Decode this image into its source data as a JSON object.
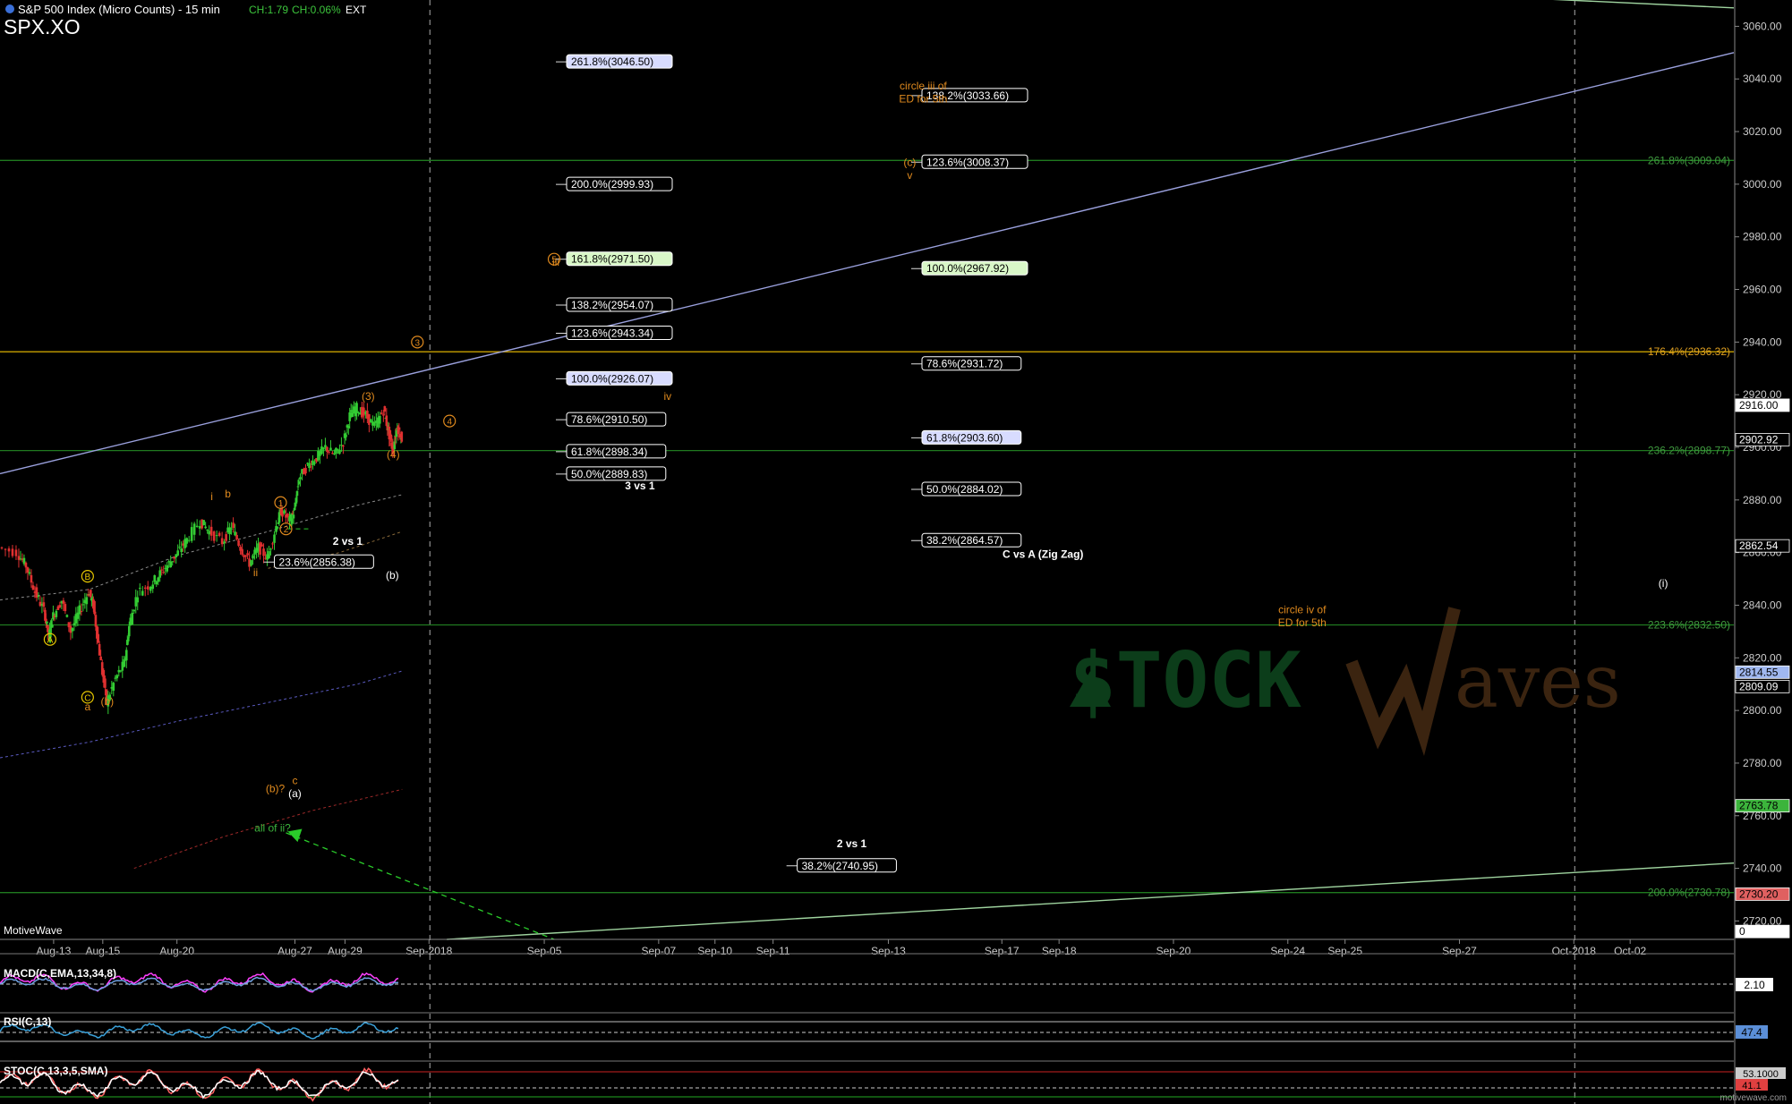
{
  "header": {
    "title": "S&P 500 Index (Micro Counts) - 15 min",
    "change": "CH:1.79",
    "change_pct": "CH:0.06%",
    "session": "EXT",
    "symbol": "SPX.XO"
  },
  "colors": {
    "background": "#000000",
    "grid": "#111111",
    "orange": "#e08a1e",
    "green": "#3cb43c",
    "white": "#ffffff",
    "lavender": "#a0a8e6",
    "dark_green_level": "#1f7a1f",
    "gold_level": "#c8a000",
    "up_candle": "#33cc33",
    "down_candle": "#e03030",
    "dashed_cyan": "#2f6f90"
  },
  "chart_data": {
    "type": "candlestick",
    "title": "S&P 500 Index (Micro Counts) - 15 min",
    "ylim": [
      2713,
      3070
    ],
    "y_ticks": [
      2720,
      2740,
      2760,
      2780,
      2800,
      2820,
      2840,
      2860,
      2880,
      2900,
      2920,
      2940,
      2960,
      2980,
      3000,
      3020,
      3040,
      3060
    ],
    "x_ticks": [
      {
        "label": "Aug-13",
        "slot": 0.06
      },
      {
        "label": "Aug-15",
        "slot": 0.115
      },
      {
        "label": "Aug-20",
        "slot": 0.198
      },
      {
        "label": "Aug-27",
        "slot": 0.33
      },
      {
        "label": "Aug-29",
        "slot": 0.386
      },
      {
        "label": "Sep-2018",
        "slot": 0.48
      },
      {
        "label": "Sep-05",
        "slot": 0.609
      },
      {
        "label": "Sep-07",
        "slot": 0.737
      },
      {
        "label": "Sep-10",
        "slot": 0.8
      },
      {
        "label": "Sep-11",
        "slot": 0.865
      },
      {
        "label": "Sep-13",
        "slot": 0.994
      },
      {
        "label": "Sep-17",
        "slot": 1.121
      },
      {
        "label": "Sep-18",
        "slot": 1.185
      },
      {
        "label": "Sep-20",
        "slot": 1.313
      },
      {
        "label": "Sep-24",
        "slot": 1.441
      },
      {
        "label": "Sep-25",
        "slot": 1.505
      },
      {
        "label": "Sep-27",
        "slot": 1.633
      },
      {
        "label": "Oct-2018",
        "slot": 1.761
      },
      {
        "label": "Oct-02",
        "slot": 1.824
      }
    ],
    "x_extent": [
      0,
      1.94
    ],
    "price_path": [
      [
        0.0,
        2862
      ],
      [
        0.02,
        2860
      ],
      [
        0.03,
        2855
      ],
      [
        0.04,
        2845
      ],
      [
        0.05,
        2838
      ],
      [
        0.055,
        2828
      ],
      [
        0.06,
        2836
      ],
      [
        0.07,
        2842
      ],
      [
        0.08,
        2830
      ],
      [
        0.09,
        2838
      ],
      [
        0.1,
        2845
      ],
      [
        0.105,
        2840
      ],
      [
        0.112,
        2822
      ],
      [
        0.12,
        2803
      ],
      [
        0.13,
        2812
      ],
      [
        0.14,
        2818
      ],
      [
        0.145,
        2832
      ],
      [
        0.155,
        2845
      ],
      [
        0.17,
        2848
      ],
      [
        0.18,
        2852
      ],
      [
        0.19,
        2856
      ],
      [
        0.2,
        2860
      ],
      [
        0.21,
        2865
      ],
      [
        0.225,
        2872
      ],
      [
        0.235,
        2868
      ],
      [
        0.25,
        2864
      ],
      [
        0.26,
        2870
      ],
      [
        0.27,
        2862
      ],
      [
        0.28,
        2856
      ],
      [
        0.29,
        2862
      ],
      [
        0.3,
        2858
      ],
      [
        0.31,
        2870
      ],
      [
        0.315,
        2876
      ],
      [
        0.325,
        2872
      ],
      [
        0.33,
        2876
      ],
      [
        0.335,
        2888
      ],
      [
        0.345,
        2893
      ],
      [
        0.355,
        2896
      ],
      [
        0.365,
        2900
      ],
      [
        0.375,
        2897
      ],
      [
        0.385,
        2902
      ],
      [
        0.392,
        2912
      ],
      [
        0.4,
        2915
      ],
      [
        0.41,
        2912
      ],
      [
        0.42,
        2908
      ],
      [
        0.43,
        2914
      ],
      [
        0.435,
        2906
      ],
      [
        0.44,
        2899
      ],
      [
        0.445,
        2908
      ],
      [
        0.45,
        2903
      ]
    ],
    "horizontal_levels": [
      {
        "label": "261.8%(3009.04)",
        "value": 3009.04,
        "color": "dark_green_level"
      },
      {
        "label": "176.4%(2936.32)",
        "value": 2936.32,
        "color": "gold_level"
      },
      {
        "label": "236.2%(2898.77)",
        "value": 2898.77,
        "color": "dark_green_level"
      },
      {
        "label": "223.6%(2832.50)",
        "value": 2832.5,
        "color": "dark_green_level"
      },
      {
        "label": "200.0%(2730.78)",
        "value": 2730.78,
        "color": "dark_green_level"
      }
    ],
    "fib_left": [
      {
        "label": "261.8%(3046.50)",
        "value": 3046.5,
        "style": "lavender"
      },
      {
        "label": "200.0%(2999.93)",
        "value": 2999.93,
        "style": "plain"
      },
      {
        "label": "161.8%(2971.50)",
        "value": 2971.5,
        "style": "green"
      },
      {
        "label": "138.2%(2954.07)",
        "value": 2954.07,
        "style": "plain"
      },
      {
        "label": "123.6%(2943.34)",
        "value": 2943.34,
        "style": "plain"
      },
      {
        "label": "100.0%(2926.07)",
        "value": 2926.07,
        "style": "lavender"
      },
      {
        "label": "78.6%(2910.50)",
        "value": 2910.5,
        "style": "plain"
      },
      {
        "label": "61.8%(2898.34)",
        "value": 2898.34,
        "style": "plain"
      },
      {
        "label": "50.0%(2889.83)",
        "value": 2889.83,
        "style": "plain"
      }
    ],
    "fib_right": [
      {
        "label": "138.2%(3033.66)",
        "value": 3033.66,
        "style": "plain"
      },
      {
        "label": "123.6%(3008.37)",
        "value": 3008.37,
        "style": "plain"
      },
      {
        "label": "100.0%(2967.92)",
        "value": 2967.92,
        "style": "green"
      },
      {
        "label": "78.6%(2931.72)",
        "value": 2931.72,
        "style": "plain"
      },
      {
        "label": "61.8%(2903.60)",
        "value": 2903.6,
        "style": "lavender"
      },
      {
        "label": "50.0%(2884.02)",
        "value": 2884.02,
        "style": "plain"
      },
      {
        "label": "38.2%(2864.57)",
        "value": 2864.57,
        "style": "plain"
      }
    ],
    "fib_misc": [
      {
        "label": "23.6%(2856.38)",
        "value": 2856.38,
        "slot": 0.295
      },
      {
        "label": "38.2%(2740.95)",
        "value": 2740.95,
        "slot": 0.88
      }
    ],
    "price_tags": [
      {
        "label": "2916.00",
        "value": 2916.0,
        "color": "#ffffff",
        "text": "#000000"
      },
      {
        "label": "2902.92",
        "value": 2902.92,
        "color": "#000000",
        "text": "#ffffff"
      },
      {
        "label": "2862.54",
        "value": 2862.54,
        "color": "#000000",
        "text": "#ffffff"
      },
      {
        "label": "2814.55",
        "value": 2814.55,
        "color": "#a0b8f0",
        "text": "#000000"
      },
      {
        "label": "2809.09",
        "value": 2809.09,
        "color": "#000000",
        "text": "#ffffff"
      },
      {
        "label": "2763.78",
        "value": 2763.78,
        "color": "#3cb43c",
        "text": "#000000"
      },
      {
        "label": "2730.20",
        "value": 2730.2,
        "color": "#e06060",
        "text": "#000000"
      },
      {
        "label": "0",
        "value": 2716,
        "color": "#ffffff",
        "text": "#000000"
      }
    ],
    "annotations": [
      {
        "text": "circle iii of",
        "slot": 1.033,
        "value": 3036,
        "color": "orange"
      },
      {
        "text": "ED for 5th",
        "slot": 1.033,
        "value": 3031,
        "color": "orange"
      },
      {
        "text": "(c)",
        "slot": 1.018,
        "value": 3007,
        "color": "orange"
      },
      {
        "text": "v",
        "slot": 1.018,
        "value": 3002,
        "color": "orange"
      },
      {
        "text": "iii",
        "slot": 0.622,
        "value": 2969,
        "color": "orange"
      },
      {
        "text": "iv",
        "slot": 0.747,
        "value": 2918,
        "color": "orange"
      },
      {
        "text": "(3)",
        "slot": 0.412,
        "value": 2918,
        "color": "orange"
      },
      {
        "text": "(4)",
        "slot": 0.44,
        "value": 2896,
        "color": "orange"
      },
      {
        "text": "3 vs 1",
        "slot": 0.716,
        "value": 2884,
        "color": "white",
        "bold": true
      },
      {
        "text": "2 vs 1",
        "slot": 0.389,
        "value": 2863,
        "color": "white",
        "bold": true
      },
      {
        "text": "C vs A (Zig Zag)",
        "slot": 1.167,
        "value": 2858,
        "color": "white",
        "bold": true
      },
      {
        "text": "(b)",
        "slot": 0.439,
        "value": 2850,
        "color": "white"
      },
      {
        "text": "(i)",
        "slot": 1.861,
        "value": 2847,
        "color": "white"
      },
      {
        "text": "circle iv of",
        "slot": 1.457,
        "value": 2837,
        "color": "orange"
      },
      {
        "text": "ED for 5th",
        "slot": 1.457,
        "value": 2832,
        "color": "orange"
      },
      {
        "text": "i",
        "slot": 0.237,
        "value": 2880,
        "color": "orange"
      },
      {
        "text": "b",
        "slot": 0.255,
        "value": 2881,
        "color": "orange"
      },
      {
        "text": "ii",
        "slot": 0.286,
        "value": 2851,
        "color": "orange"
      },
      {
        "text": "(b)",
        "slot": 0.12,
        "value": 2802,
        "color": "orange"
      },
      {
        "text": "a",
        "slot": 0.098,
        "value": 2800,
        "color": "orange"
      },
      {
        "text": "(b)?",
        "slot": 0.308,
        "value": 2769,
        "color": "orange"
      },
      {
        "text": "c",
        "slot": 0.33,
        "value": 2772,
        "color": "orange"
      },
      {
        "text": "(a)",
        "slot": 0.33,
        "value": 2767,
        "color": "white"
      },
      {
        "text": "all of ii?",
        "slot": 0.305,
        "value": 2754,
        "color": "green"
      },
      {
        "text": "2 vs 1",
        "slot": 0.953,
        "value": 2748,
        "color": "white",
        "bold": true
      }
    ],
    "circled_labels": [
      {
        "text": "5",
        "slot": 0.62,
        "value": 2971.5,
        "color": "orange"
      },
      {
        "text": "3",
        "slot": 0.467,
        "value": 2940,
        "color": "orange"
      },
      {
        "text": "4",
        "slot": 0.503,
        "value": 2910,
        "color": "orange"
      },
      {
        "text": "1",
        "slot": 0.314,
        "value": 2879,
        "color": "orange"
      },
      {
        "text": "2",
        "slot": 0.32,
        "value": 2869,
        "color": "orange"
      },
      {
        "text": "B",
        "slot": 0.098,
        "value": 2851,
        "color": "yellow"
      },
      {
        "text": "A",
        "slot": 0.056,
        "value": 2827,
        "color": "yellow"
      },
      {
        "text": "C",
        "slot": 0.098,
        "value": 2805,
        "color": "yellow"
      }
    ],
    "upper_line": {
      "from": [
        0,
        3098
      ],
      "to": [
        1.94,
        3067
      ]
    },
    "channel_line": {
      "from": [
        0,
        2890
      ],
      "to": [
        1.94,
        3050
      ]
    },
    "lower_line": {
      "from": [
        0.5,
        2713
      ],
      "to": [
        1.94,
        2742
      ]
    },
    "separators": [
      0.481,
      1.762
    ]
  },
  "indicators": {
    "macd_label": "MACD(C,EMA,13,34,8)",
    "macd_value": "2.10",
    "rsi_label": "RSI(C,13)",
    "rsi_value": "47.4",
    "stoc_label": "STOC(C,13,3,5,SMA)",
    "stoc_value_top": "53.1000",
    "stoc_value_bottom": "41.1"
  },
  "watermark": {
    "logo_text": "$TOCK",
    "logo_text2": "aves",
    "site": "motivewave.com",
    "brand": "MotiveWave"
  }
}
